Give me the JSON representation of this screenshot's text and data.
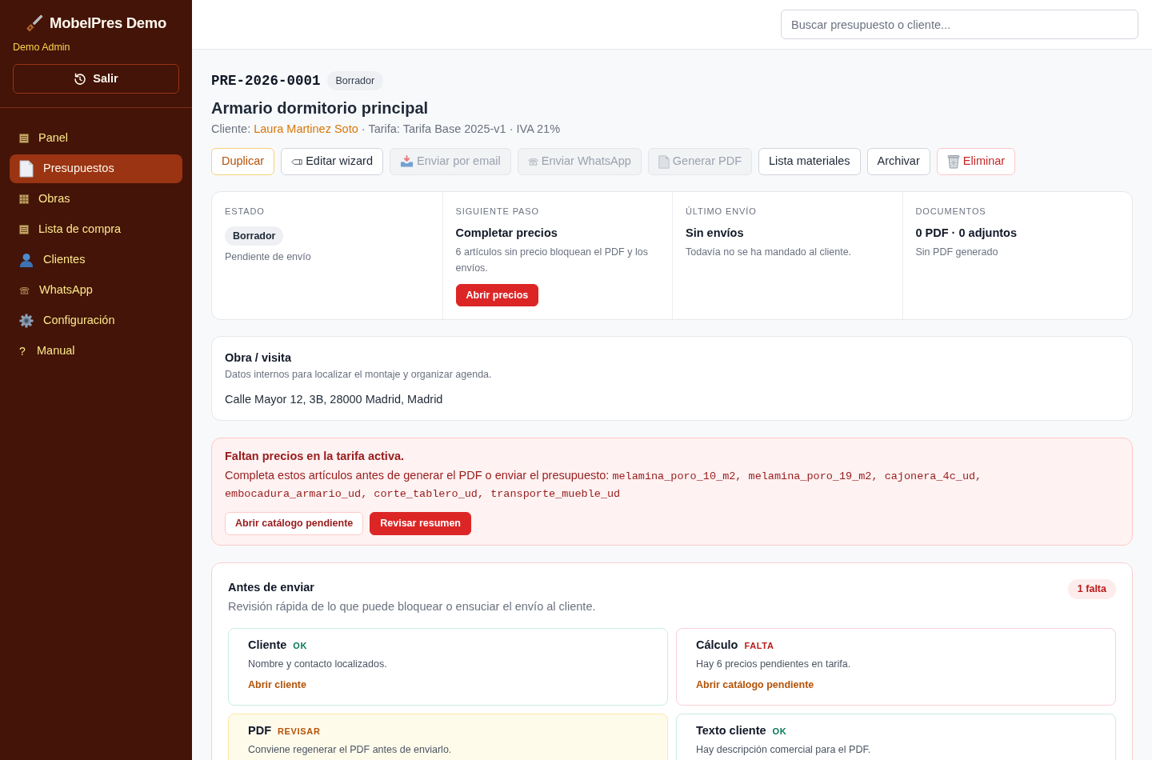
{
  "sidebar": {
    "brand": "MobelPres Demo",
    "user": "Demo Admin",
    "logout_button": "Salir",
    "items": [
      {
        "label": "Panel",
        "selected": false
      },
      {
        "label": "Presupuestos",
        "selected": true
      },
      {
        "label": "Obras",
        "selected": false
      },
      {
        "label": "Lista de compra",
        "selected": false
      },
      {
        "label": "Clientes",
        "selected": false
      },
      {
        "label": "WhatsApp",
        "selected": false
      },
      {
        "label": "Configuración",
        "selected": false
      },
      {
        "label": "Manual",
        "glyph": "?",
        "selected": false
      }
    ]
  },
  "search": {
    "placeholder": "Buscar presupuesto o cliente..."
  },
  "quote": {
    "number": "PRE-2026-0001",
    "status_badge": "Borrador",
    "title": "Armario dormitorio principal",
    "meta": {
      "prefix": "Cliente:",
      "client": "Laura Martinez Soto",
      "suffix": "· Tarifa: Tarifa Base 2025-v1 · IVA 21%"
    }
  },
  "actions": [
    {
      "label": "Duplicar",
      "kind": "accent",
      "disabled": false
    },
    {
      "label": "Editar wizard",
      "kind": "plain",
      "disabled": false
    },
    {
      "label": "Enviar por email",
      "kind": "plain",
      "disabled": true
    },
    {
      "label": "Enviar WhatsApp",
      "kind": "plain",
      "disabled": true
    },
    {
      "label": "Generar PDF",
      "kind": "plain",
      "disabled": true
    },
    {
      "label": "Lista materiales",
      "kind": "plain",
      "disabled": false
    },
    {
      "label": "Archivar",
      "kind": "plain",
      "disabled": false
    },
    {
      "label": "Eliminar",
      "kind": "danger",
      "disabled": false
    }
  ],
  "summary": [
    {
      "label": "ESTADO",
      "badge": "Borrador",
      "text": "Pendiente de envío"
    },
    {
      "label": "SIGUIENTE PASO",
      "title": "Completar precios",
      "text": "6 artículos sin precio bloquean el PDF y los envíos.",
      "button": "Abrir precios"
    },
    {
      "label": "ÚLTIMO ENVÍO",
      "title": "Sin envíos",
      "text": "Todavía no se ha mandado al cliente."
    },
    {
      "label": "DOCUMENTOS",
      "title": "0 PDF · 0 adjuntos",
      "text": "Sin PDF generado"
    }
  ],
  "site": {
    "title": "Obra / visita",
    "description": "Datos internos para localizar el montaje y organizar agenda.",
    "address": "Calle Mayor 12, 3B, 28000 Madrid, Madrid"
  },
  "alert": {
    "title": "Faltan precios en la tarifa activa.",
    "message": "Completa estos artículos antes de generar el PDF o enviar el presupuesto:",
    "codes": "melamina_poro_10_m2, melamina_poro_19_m2, cajonera_4c_ud, embocadura_armario_ud, corte_tablero_ud, transporte_mueble_ud",
    "buttons": [
      {
        "label": "Abrir catálogo pendiente",
        "kind": "outline"
      },
      {
        "label": "Revisar resumen",
        "kind": "solid"
      }
    ]
  },
  "checklist": {
    "title": "Antes de enviar",
    "subtitle": "Revisión rápida de lo que puede bloquear o ensuciar el envío al cliente.",
    "badge": "1 falta",
    "items": [
      {
        "title": "Cliente",
        "status": "OK",
        "kind": "ok",
        "text": "Nombre y contacto localizados.",
        "link": "Abrir cliente"
      },
      {
        "title": "Cálculo",
        "status": "FALTA",
        "kind": "missing",
        "text": "Hay 6 precios pendientes en tarifa.",
        "link": "Abrir catálogo pendiente"
      },
      {
        "title": "PDF",
        "status": "REVISAR",
        "kind": "review",
        "text": "Conviene regenerar el PDF antes de enviarlo."
      },
      {
        "title": "Texto cliente",
        "status": "OK",
        "kind": "ok",
        "text": "Hay descripción comercial para el PDF."
      }
    ]
  }
}
